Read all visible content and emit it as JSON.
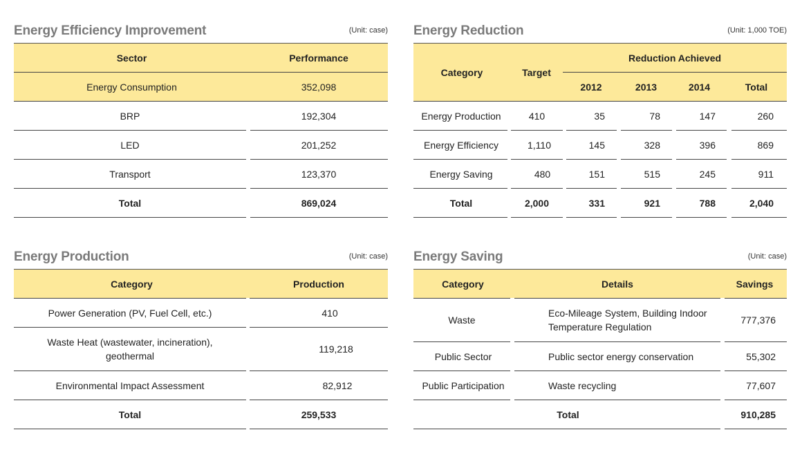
{
  "efficiency": {
    "title": "Energy Efficiency Improvement",
    "unit": "(Unit: case)",
    "headers": {
      "sector": "Sector",
      "performance": "Performance"
    },
    "rows": [
      {
        "sector": "Energy Consumption",
        "performance": "352,098"
      },
      {
        "sector": "BRP",
        "performance": "192,304"
      },
      {
        "sector": "LED",
        "performance": "201,252"
      },
      {
        "sector": "Transport",
        "performance": "123,370"
      },
      {
        "sector": "Total",
        "performance": "869,024"
      }
    ]
  },
  "reduction": {
    "title": "Energy Reduction",
    "unit": "(Unit: 1,000 TOE)",
    "headers": {
      "category": "Category",
      "target": "Target",
      "achieved": "Reduction Achieved",
      "y2012": "2012",
      "y2013": "2013",
      "y2014": "2014",
      "total": "Total"
    },
    "rows": [
      {
        "category": "Energy Production",
        "target": "410",
        "y2012": "35",
        "y2013": "78",
        "y2014": "147",
        "total": "260"
      },
      {
        "category": "Energy Efficiency",
        "target": "1,110",
        "y2012": "145",
        "y2013": "328",
        "y2014": "396",
        "total": "869"
      },
      {
        "category": "Energy Saving",
        "target": "480",
        "y2012": "151",
        "y2013": "515",
        "y2014": "245",
        "total": "911"
      },
      {
        "category": "Total",
        "target": "2,000",
        "y2012": "331",
        "y2013": "921",
        "y2014": "788",
        "total": "2,040"
      }
    ]
  },
  "production": {
    "title": "Energy Production",
    "unit": "(Unit: case)",
    "headers": {
      "category": "Category",
      "production": "Production"
    },
    "rows": [
      {
        "category": "Power Generation (PV, Fuel Cell, etc.)",
        "production": "410"
      },
      {
        "category_line1": "Waste Heat (wastewater, incineration),",
        "category_line2": "geothermal",
        "production": "119,218"
      },
      {
        "category": "Environmental Impact Assessment",
        "production": "82,912"
      },
      {
        "category": "Total",
        "production": "259,533"
      }
    ]
  },
  "saving": {
    "title": "Energy Saving",
    "unit": "(Unit: case)",
    "headers": {
      "category": "Category",
      "details": "Details",
      "savings": "Savings"
    },
    "rows": [
      {
        "category": "Waste",
        "details_line1": "Eco-Mileage System, Building Indoor",
        "details_line2": "Temperature Regulation",
        "savings": "777,376"
      },
      {
        "category": "Public Sector",
        "details": "Public sector energy conservation",
        "savings": "55,302"
      },
      {
        "category": "Public Participation",
        "details": "Waste recycling",
        "savings": "77,607"
      },
      {
        "details": "Total",
        "savings": "910,285"
      }
    ]
  }
}
